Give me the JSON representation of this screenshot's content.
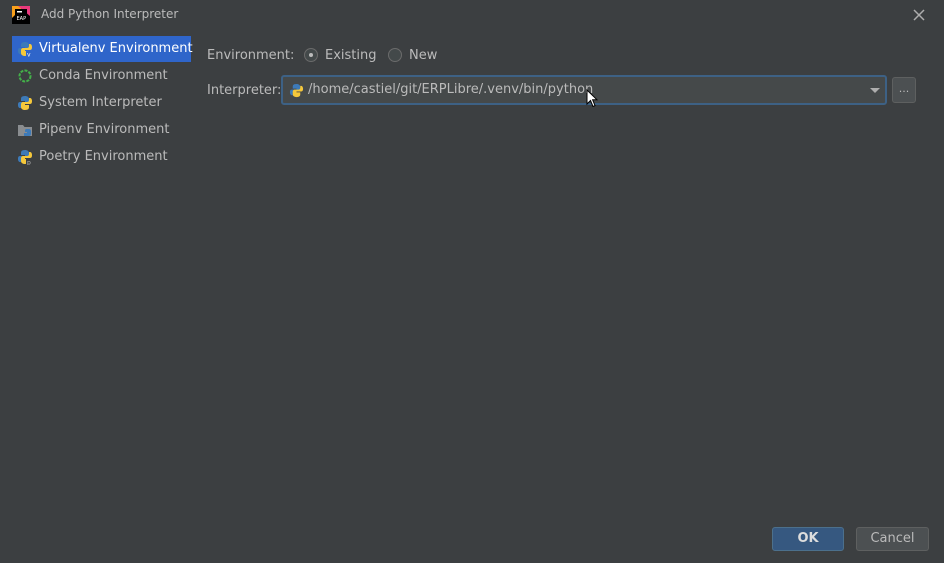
{
  "window": {
    "title": "Add Python Interpreter"
  },
  "sidebar": {
    "items": [
      {
        "label": "Virtualenv Environment",
        "icon": "python-virtualenv-icon",
        "selected": true
      },
      {
        "label": "Conda Environment",
        "icon": "conda-icon",
        "selected": false
      },
      {
        "label": "System Interpreter",
        "icon": "python-icon",
        "selected": false
      },
      {
        "label": "Pipenv Environment",
        "icon": "pipenv-icon",
        "selected": false
      },
      {
        "label": "Poetry Environment",
        "icon": "poetry-icon",
        "selected": false
      }
    ]
  },
  "form": {
    "environment_label": "Environment:",
    "environment_options": [
      {
        "label": "Existing",
        "selected": true
      },
      {
        "label": "New",
        "selected": false
      }
    ],
    "interpreter_label": "Interpreter:",
    "interpreter_value": "/home/castiel/git/ERPLibre/.venv/bin/python",
    "browse_label": "..."
  },
  "buttons": {
    "ok": "OK",
    "cancel": "Cancel"
  },
  "colors": {
    "background": "#3c3f41",
    "selection": "#2f65ca",
    "focus_border": "#3d6185",
    "default_button": "#365880"
  }
}
